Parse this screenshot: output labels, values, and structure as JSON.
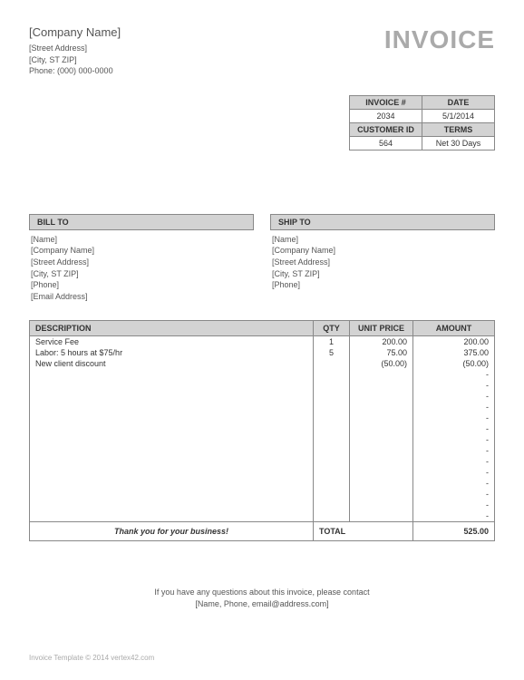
{
  "header": {
    "company_name": "[Company Name]",
    "street": "[Street Address]",
    "city": "[City, ST  ZIP]",
    "phone": "Phone: (000) 000-0000",
    "title": "INVOICE"
  },
  "meta": {
    "invoice_no_label": "INVOICE #",
    "date_label": "DATE",
    "invoice_no": "2034",
    "date": "5/1/2014",
    "customer_id_label": "CUSTOMER ID",
    "terms_label": "TERMS",
    "customer_id": "564",
    "terms": "Net 30 Days"
  },
  "bill_to": {
    "header": "BILL TO",
    "name": "[Name]",
    "company": "[Company Name]",
    "street": "[Street Address]",
    "city": "[City, ST  ZIP]",
    "phone": "[Phone]",
    "email": "[Email Address]"
  },
  "ship_to": {
    "header": "SHIP TO",
    "name": "[Name]",
    "company": "[Company Name]",
    "street": "[Street Address]",
    "city": "[City, ST  ZIP]",
    "phone": "[Phone]"
  },
  "items": {
    "desc_label": "DESCRIPTION",
    "qty_label": "QTY",
    "unit_label": "UNIT PRICE",
    "amount_label": "AMOUNT",
    "rows": [
      {
        "desc": "Service Fee",
        "qty": "1",
        "unit": "200.00",
        "amount": "200.00"
      },
      {
        "desc": "Labor: 5 hours at $75/hr",
        "qty": "5",
        "unit": "75.00",
        "amount": "375.00"
      },
      {
        "desc": "New client discount",
        "qty": "",
        "unit": "(50.00)",
        "amount": "(50.00)"
      },
      {
        "desc": "",
        "qty": "",
        "unit": "",
        "amount": "-"
      },
      {
        "desc": "",
        "qty": "",
        "unit": "",
        "amount": "-"
      },
      {
        "desc": "",
        "qty": "",
        "unit": "",
        "amount": "-"
      },
      {
        "desc": "",
        "qty": "",
        "unit": "",
        "amount": "-"
      },
      {
        "desc": "",
        "qty": "",
        "unit": "",
        "amount": "-"
      },
      {
        "desc": "",
        "qty": "",
        "unit": "",
        "amount": "-"
      },
      {
        "desc": "",
        "qty": "",
        "unit": "",
        "amount": "-"
      },
      {
        "desc": "",
        "qty": "",
        "unit": "",
        "amount": "-"
      },
      {
        "desc": "",
        "qty": "",
        "unit": "",
        "amount": "-"
      },
      {
        "desc": "",
        "qty": "",
        "unit": "",
        "amount": "-"
      },
      {
        "desc": "",
        "qty": "",
        "unit": "",
        "amount": "-"
      },
      {
        "desc": "",
        "qty": "",
        "unit": "",
        "amount": "-"
      },
      {
        "desc": "",
        "qty": "",
        "unit": "",
        "amount": "-"
      },
      {
        "desc": "",
        "qty": "",
        "unit": "",
        "amount": "-"
      }
    ],
    "thank_you": "Thank you for your business!",
    "total_label": "TOTAL",
    "total": "525.00"
  },
  "footer": {
    "contact1": "If you have any questions about this invoice, please contact",
    "contact2": "[Name, Phone, email@address.com]",
    "copyright": "Invoice Template © 2014 vertex42.com"
  }
}
